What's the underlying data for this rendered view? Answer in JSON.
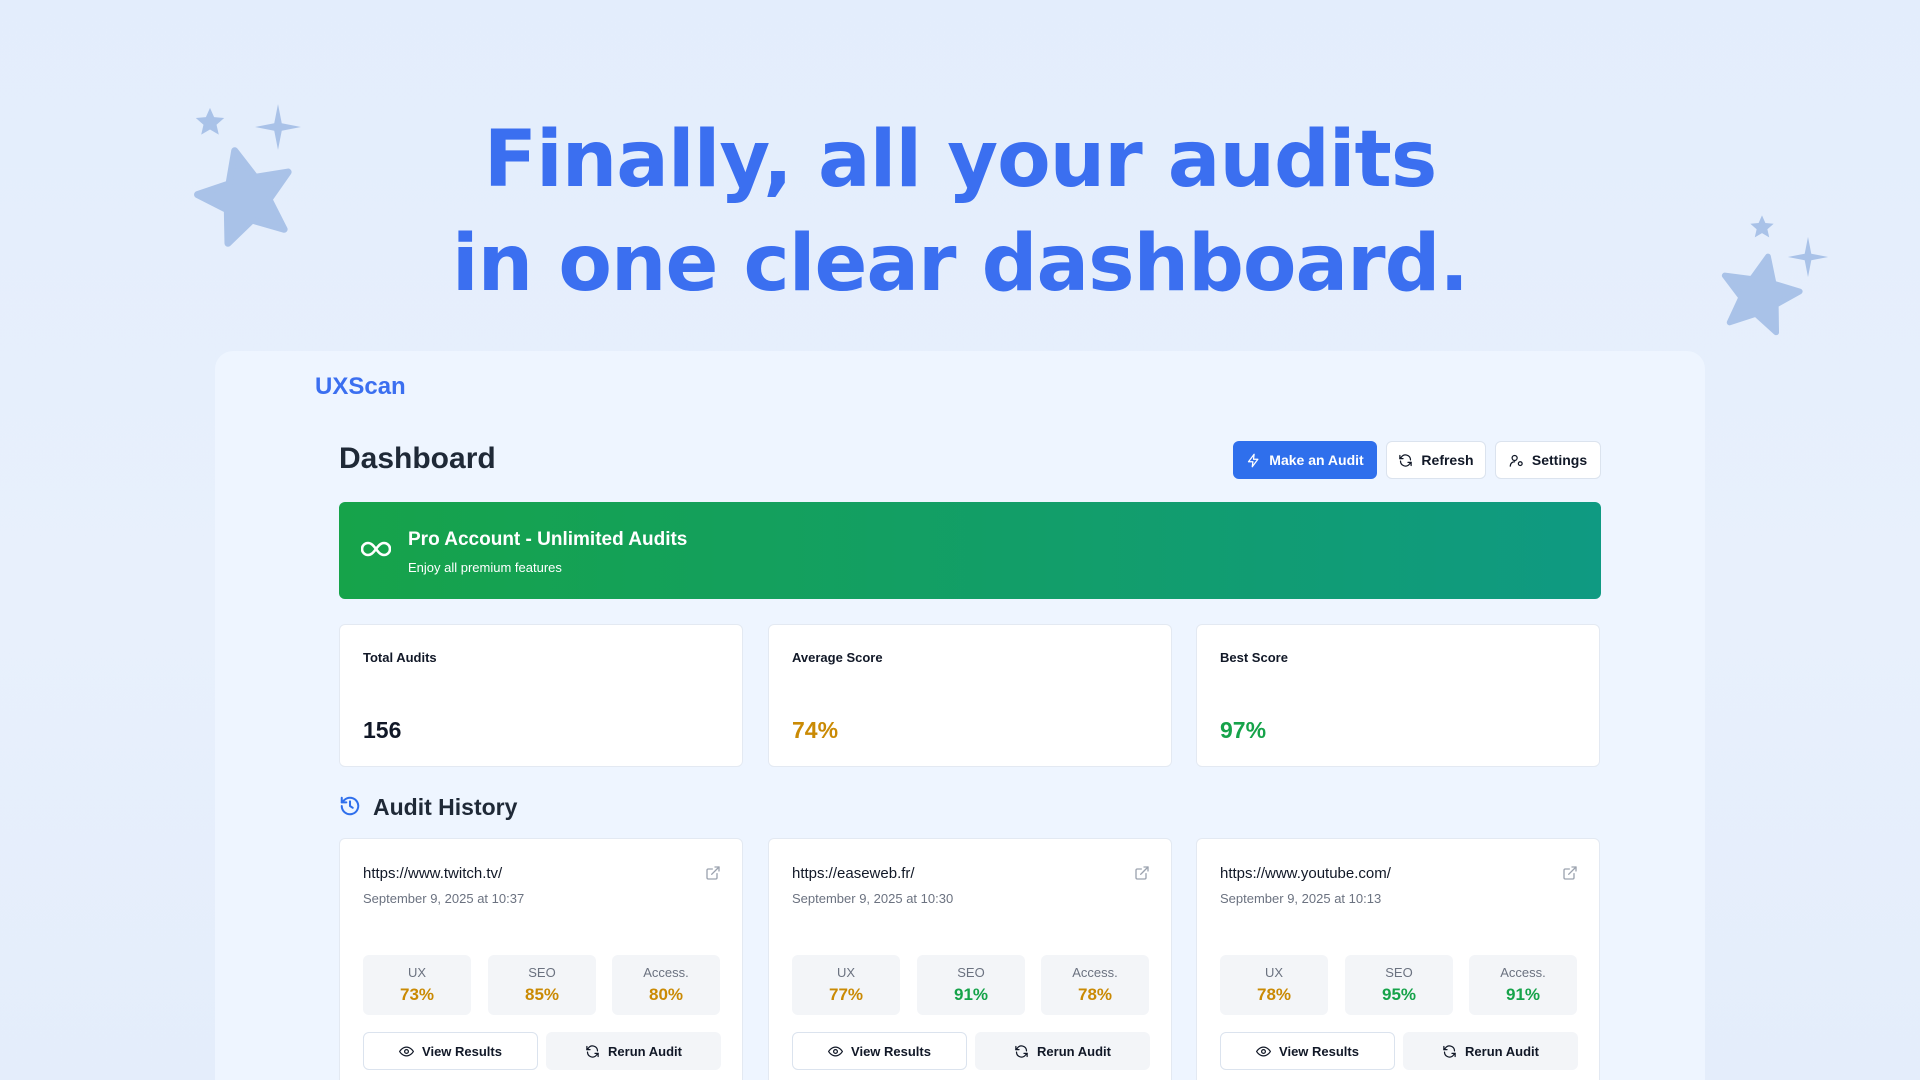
{
  "hero": {
    "line1": "Finally, all your audits",
    "line2": "in one clear dashboard."
  },
  "app": {
    "brand": "UXScan",
    "page_title": "Dashboard",
    "buttons": {
      "make_audit": "Make an Audit",
      "refresh": "Refresh",
      "settings": "Settings"
    }
  },
  "banner": {
    "title": "Pro Account - Unlimited Audits",
    "subtitle": "Enjoy all premium features",
    "icon": "infinity-icon"
  },
  "stats": [
    {
      "label": "Total Audits",
      "value": "156",
      "color": "#111827"
    },
    {
      "label": "Average Score",
      "value": "74%",
      "color": "#ca8a04"
    },
    {
      "label": "Best Score",
      "value": "97%",
      "color": "#16a34a"
    }
  ],
  "history": {
    "title": "Audit History",
    "icon": "history-icon",
    "items": [
      {
        "url": "https://www.twitch.tv/",
        "date": "September 9, 2025 at 10:37",
        "scores": [
          {
            "label": "UX",
            "value": "73%",
            "color": "#ca8a04"
          },
          {
            "label": "SEO",
            "value": "85%",
            "color": "#ca8a04"
          },
          {
            "label": "Access.",
            "value": "80%",
            "color": "#ca8a04"
          }
        ],
        "view_label": "View Results",
        "rerun_label": "Rerun Audit"
      },
      {
        "url": "https://easeweb.fr/",
        "date": "September 9, 2025 at 10:30",
        "scores": [
          {
            "label": "UX",
            "value": "77%",
            "color": "#ca8a04"
          },
          {
            "label": "SEO",
            "value": "91%",
            "color": "#16a34a"
          },
          {
            "label": "Access.",
            "value": "78%",
            "color": "#ca8a04"
          }
        ],
        "view_label": "View Results",
        "rerun_label": "Rerun Audit"
      },
      {
        "url": "https://www.youtube.com/",
        "date": "September 9, 2025 at 10:13",
        "scores": [
          {
            "label": "UX",
            "value": "78%",
            "color": "#ca8a04"
          },
          {
            "label": "SEO",
            "value": "95%",
            "color": "#16a34a"
          },
          {
            "label": "Access.",
            "value": "91%",
            "color": "#16a34a"
          }
        ],
        "view_label": "View Results",
        "rerun_label": "Rerun Audit"
      }
    ]
  },
  "colors": {
    "accent": "#3b6ff0",
    "primary_button": "#2f6fec",
    "banner_start": "#16a34a",
    "banner_end": "#0f9a82"
  }
}
